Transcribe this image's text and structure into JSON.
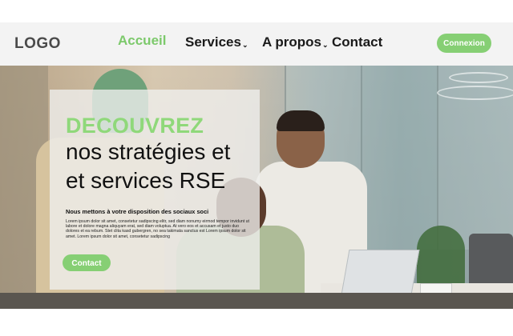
{
  "header": {
    "logo": "LOGO",
    "nav": [
      {
        "label": "Accueil",
        "active": true,
        "dropdown": false
      },
      {
        "label": "Services",
        "active": false,
        "dropdown": true
      },
      {
        "label": "A propos",
        "active": false,
        "dropdown": true
      },
      {
        "label": "Contact",
        "active": false,
        "dropdown": false
      }
    ],
    "dropdown_icon": "chevron-down-icon",
    "login_label": "Connexion"
  },
  "hero": {
    "headline_accent": "DECOUVREZ",
    "headline_line1": "nos stratégies et",
    "headline_line2": "et services RSE",
    "subtitle": "Nous mettons à votre disposition des sociaux soci",
    "body": "Lorem ipsum dolor sit amet, consetetur sadipscing elitr, sed diam nonumy eirmod tempor invidunt ut labore et dolore magna aliquyam erat, sed diam voluptua. At vero eos et accusam et justo duo dolores et ea rebum. Stet clita kasd gubergren, no sea takimata sanctus est Lorem ipsum dolor sit amet. Lorem ipsum dolor sit amet, consetetur sadipscing",
    "cta_label": "Contact"
  },
  "colors": {
    "accent": "#86cf74",
    "accent_text": "#8fd87a",
    "header_bg": "#f3f3f3",
    "dark_text": "#111111"
  }
}
